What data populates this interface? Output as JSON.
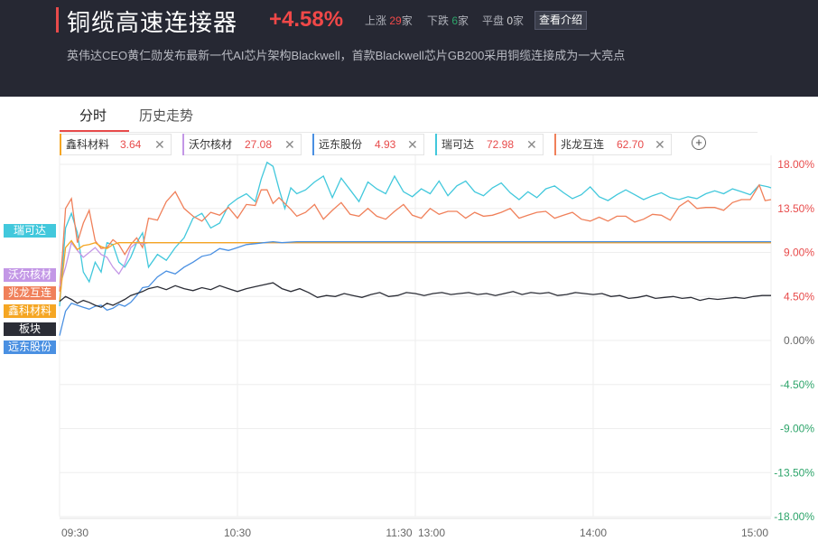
{
  "header": {
    "title": "铜缆高速连接器",
    "change_pct": "+4.58%",
    "up_label": "上涨",
    "up_count": "29",
    "up_unit": "家",
    "down_label": "下跌",
    "down_count": "6",
    "down_unit": "家",
    "flat_label": "平盘",
    "flat_count": "0",
    "flat_unit": "家",
    "intro_button": "查看介绍",
    "description": "英伟达CEO黄仁勋发布最新一代AI芯片架构Blackwell，首款Blackwell芯片GB200采用铜缆连接成为一大亮点"
  },
  "tabs": [
    {
      "label": "分时",
      "active": true
    },
    {
      "label": "历史走势",
      "active": false
    }
  ],
  "legend": [
    {
      "name": "鑫科材料",
      "value": "3.64",
      "color": "#f5a623"
    },
    {
      "name": "沃尔核材",
      "value": "27.08",
      "color": "#c397e6"
    },
    {
      "name": "远东股份",
      "value": "4.93",
      "color": "#4a90e2"
    },
    {
      "name": "瑞可达",
      "value": "72.98",
      "color": "#42c8dc"
    },
    {
      "name": "兆龙互连",
      "value": "62.70",
      "color": "#f0805a"
    }
  ],
  "add_icon": "plus-circle-icon",
  "close_icon": "close-icon",
  "side_labels": [
    {
      "name": "瑞可达",
      "color": "#42c8dc"
    },
    {
      "name": "沃尔核材",
      "color": "#c397e6"
    },
    {
      "name": "兆龙互连",
      "color": "#f0805a"
    },
    {
      "name": "鑫科材料",
      "color": "#f5a623"
    },
    {
      "name": "板块",
      "color": "#2b2d36"
    },
    {
      "name": "远东股份",
      "color": "#4a90e2"
    }
  ],
  "chart_data": {
    "type": "line",
    "ylim": [
      -18,
      18
    ],
    "y_ticks": [
      "18.00%",
      "13.50%",
      "9.00%",
      "4.50%",
      "0.00%",
      "-4.50%",
      "-9.00%",
      "-13.50%",
      "-18.00%"
    ],
    "y_tick_values": [
      18,
      13.5,
      9,
      4.5,
      0,
      -4.5,
      -9,
      -13.5,
      -18
    ],
    "x_ticks": [
      "09:30",
      "10:30",
      "11:30",
      "13:00",
      "14:00",
      "15:00"
    ],
    "x_tick_minutes": [
      0,
      60,
      120,
      120,
      180,
      240
    ],
    "x_range_minutes": [
      0,
      240
    ],
    "grid": true,
    "series": [
      {
        "name": "瑞可达",
        "color": "#42c8dc",
        "x": [
          0,
          2,
          4,
          6,
          8,
          10,
          12,
          14,
          16,
          18,
          20,
          22,
          24,
          26,
          28,
          30,
          33,
          36,
          39,
          42,
          45,
          48,
          51,
          54,
          57,
          60,
          63,
          66,
          68,
          70,
          72,
          74,
          76,
          78,
          80,
          83,
          86,
          89,
          92,
          95,
          98,
          101,
          104,
          107,
          110,
          113,
          116,
          119,
          122,
          125,
          128,
          131,
          134,
          137,
          140,
          143,
          146,
          149,
          152,
          155,
          158,
          161,
          164,
          167,
          170,
          173,
          176,
          179,
          182,
          185,
          188,
          191,
          194,
          197,
          200,
          203,
          206,
          209,
          212,
          215,
          218,
          221,
          224,
          227,
          230,
          233,
          236,
          239,
          240
        ],
        "y": [
          3.5,
          11.5,
          13,
          11,
          7,
          6,
          8,
          7,
          10,
          9.8,
          8,
          7.5,
          8.5,
          10,
          11,
          7.5,
          8.8,
          8.2,
          9.5,
          10.5,
          12.5,
          13,
          11.5,
          12,
          13.8,
          14.5,
          15,
          14.2,
          16.5,
          18.2,
          17.8,
          15.5,
          13.5,
          15.6,
          15,
          15.4,
          16.2,
          16.8,
          14.6,
          16.6,
          15.4,
          14.2,
          16.2,
          15.5,
          15,
          16.8,
          15.2,
          14.7,
          15.5,
          15,
          16.3,
          14.8,
          15.8,
          16.3,
          15.2,
          14.8,
          15.6,
          16.1,
          15.1,
          14.4,
          15.2,
          14.6,
          15.5,
          15.8,
          15.1,
          14.5,
          14.9,
          15.7,
          14.7,
          14.3,
          14.9,
          15.4,
          14.9,
          14.4,
          14.8,
          15.1,
          14.6,
          14.4,
          14.7,
          14.5,
          15,
          15.3,
          15,
          15.5,
          15.2,
          14.9,
          15.9,
          15.7,
          15.6
        ]
      },
      {
        "name": "兆龙互连",
        "color": "#f0805a",
        "x": [
          0,
          1,
          2,
          4,
          6,
          8,
          10,
          12,
          14,
          16,
          18,
          20,
          22,
          24,
          26,
          28,
          30,
          33,
          36,
          39,
          42,
          45,
          48,
          51,
          54,
          57,
          60,
          63,
          66,
          68,
          70,
          72,
          74,
          76,
          78,
          80,
          83,
          86,
          89,
          92,
          95,
          98,
          101,
          104,
          107,
          110,
          113,
          116,
          119,
          122,
          125,
          128,
          131,
          134,
          137,
          140,
          143,
          146,
          149,
          152,
          155,
          158,
          161,
          164,
          167,
          170,
          173,
          176,
          179,
          182,
          185,
          188,
          191,
          194,
          197,
          200,
          203,
          206,
          209,
          212,
          215,
          218,
          221,
          224,
          227,
          230,
          233,
          236,
          238,
          240
        ],
        "y": [
          5,
          9,
          13.5,
          14.5,
          10,
          12,
          13.3,
          10.2,
          9.4,
          9.5,
          10.3,
          9.8,
          8.8,
          9.8,
          10.5,
          9.5,
          12.5,
          12.3,
          14.2,
          15.2,
          13.5,
          12.7,
          12.2,
          13.1,
          12.8,
          13.6,
          12.5,
          13.9,
          13.8,
          15.4,
          15.4,
          14,
          14.6,
          14,
          13.4,
          12.7,
          13.1,
          13.9,
          12.4,
          13.3,
          14.1,
          12.9,
          12.7,
          13.5,
          12.7,
          12.4,
          13.2,
          13.9,
          12.8,
          12.5,
          13.5,
          12.9,
          13.2,
          13.2,
          12.5,
          13.1,
          12.7,
          12.8,
          13.1,
          13.5,
          12.5,
          12.8,
          13.1,
          13.2,
          12.5,
          12.8,
          13.1,
          12.4,
          12.2,
          12.6,
          12.2,
          12.7,
          12.7,
          12.1,
          12.4,
          12.9,
          12.8,
          12.3,
          13.7,
          14.3,
          13.5,
          13.6,
          13.6,
          13.3,
          14.1,
          14.4,
          14.4,
          15.9,
          14.3,
          14.4
        ]
      },
      {
        "name": "沃尔核材",
        "color": "#c397e6",
        "x": [
          0,
          2,
          4,
          6,
          8,
          10,
          12,
          14,
          16,
          18,
          20,
          22,
          24,
          26,
          28,
          30,
          35,
          40,
          240
        ],
        "y": [
          5.5,
          7.5,
          10,
          9.2,
          8.5,
          9,
          9.5,
          8.8,
          8.5,
          7.5,
          6.8,
          7.8,
          9.5,
          10,
          9.9,
          10,
          10,
          10,
          10
        ]
      },
      {
        "name": "鑫科材料",
        "color": "#f5a623",
        "x": [
          0,
          2,
          4,
          6,
          8,
          10,
          12,
          14,
          16,
          18,
          20,
          22,
          24,
          26,
          28,
          30,
          35,
          40,
          240
        ],
        "y": [
          4,
          9.5,
          10.2,
          9.3,
          9.7,
          9.8,
          10,
          9.6,
          9.4,
          9.8,
          10,
          10,
          10,
          10,
          10,
          10,
          10,
          10,
          10
        ]
      },
      {
        "name": "远东股份",
        "color": "#4a90e2",
        "x": [
          0,
          2,
          4,
          6,
          8,
          10,
          12,
          14,
          16,
          18,
          20,
          22,
          24,
          26,
          28,
          30,
          33,
          36,
          39,
          42,
          45,
          48,
          51,
          54,
          57,
          60,
          63,
          66,
          69,
          72,
          75,
          80,
          85,
          240
        ],
        "y": [
          0.5,
          3,
          3.8,
          3.6,
          3.4,
          3.2,
          3.5,
          3.6,
          3.1,
          3.3,
          3.7,
          3.5,
          3.9,
          4.6,
          5.4,
          5.5,
          6.5,
          7.1,
          6.8,
          7.5,
          8,
          8.6,
          8.8,
          9.4,
          9.2,
          9.5,
          9.8,
          9.9,
          10,
          10.1,
          10,
          10.1,
          10.1,
          10.1
        ]
      },
      {
        "name": "板块",
        "color": "#2b2d36",
        "x": [
          0,
          2,
          4,
          6,
          8,
          10,
          12,
          14,
          16,
          18,
          20,
          22,
          24,
          26,
          28,
          30,
          33,
          36,
          39,
          42,
          45,
          48,
          51,
          54,
          57,
          60,
          63,
          66,
          69,
          72,
          75,
          78,
          81,
          84,
          87,
          90,
          93,
          96,
          99,
          102,
          105,
          108,
          111,
          114,
          117,
          120,
          123,
          126,
          129,
          132,
          135,
          138,
          141,
          144,
          147,
          150,
          153,
          156,
          159,
          162,
          165,
          168,
          171,
          174,
          177,
          180,
          183,
          186,
          189,
          192,
          195,
          198,
          201,
          204,
          207,
          210,
          213,
          216,
          219,
          222,
          225,
          228,
          231,
          234,
          237,
          240
        ],
        "y": [
          4,
          4.5,
          4.2,
          3.8,
          4.1,
          3.9,
          3.6,
          3.4,
          3.8,
          3.6,
          3.9,
          4.2,
          4.6,
          4.8,
          5,
          5.3,
          5.5,
          5.2,
          5.6,
          5.3,
          5.1,
          5.4,
          5.2,
          5.6,
          5.3,
          5,
          5.3,
          5.5,
          5.7,
          5.9,
          5.3,
          5,
          5.3,
          4.9,
          4.4,
          4.6,
          4.5,
          4.8,
          4.6,
          4.4,
          4.7,
          4.9,
          4.5,
          4.6,
          4.9,
          4.8,
          4.6,
          4.8,
          4.9,
          4.7,
          4.8,
          4.9,
          4.7,
          4.8,
          4.6,
          4.8,
          5,
          4.7,
          4.9,
          4.8,
          4.9,
          4.6,
          4.7,
          4.9,
          4.8,
          4.7,
          4.8,
          4.5,
          4.6,
          4.3,
          4.4,
          4.6,
          4.3,
          4.4,
          4.5,
          4.3,
          4.4,
          4.1,
          4.3,
          4.2,
          4.3,
          4.4,
          4.3,
          4.5,
          4.6,
          4.6
        ]
      }
    ]
  }
}
